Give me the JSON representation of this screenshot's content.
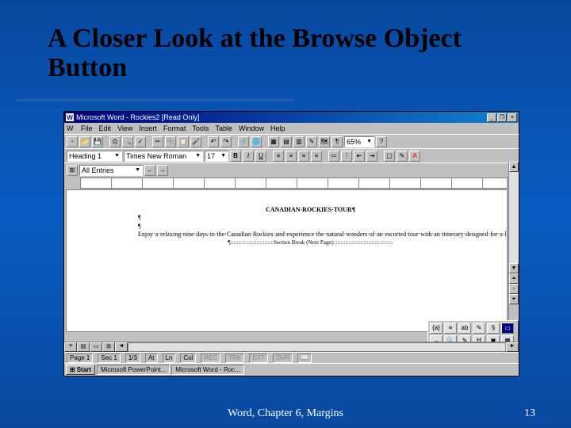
{
  "slide": {
    "title": "A Closer Look at the Browse Object Button",
    "footer_center": "Word, Chapter 6, Margins",
    "footer_right": "13"
  },
  "word": {
    "titlebar": "Microsoft Word - Rockies2 [Read Only]",
    "menus": [
      "File",
      "Edit",
      "View",
      "Insert",
      "Format",
      "Tools",
      "Table",
      "Window",
      "Help"
    ],
    "style": "Heading 1",
    "font": "Times New Roman",
    "size": "17",
    "zoom": "65%",
    "outline_level": "All Entries",
    "doc_heading": "CANADIAN·ROCKIES·TOUR",
    "body1": "Enjoy·a·relaxing·nine·days·in·the·Canadian·Rockies·and·experience·the·natural·wonders·of·an·escorted·tour·with·an·itinerary·designed·for·a·leisurely·pace.·Every·hotel·is·scheduled·for·two·nights·so·you·can·unwind·and·savor·the·scenery·and·the·inner·spa.",
    "section_break": "::::::::::::::::::::::::::::Section Break (Next Page):::::::::::::::::::::::::::::::::::::::",
    "status": {
      "page": "Page 1",
      "sec": "Sec 1",
      "pages": "1/3",
      "at": "At",
      "ln": "Ln",
      "col": "Col",
      "rec": "REC",
      "trk": "TRK",
      "ext": "EXT",
      "ovr": "OVR"
    },
    "browse_label": "Browse by Page",
    "taskbar": {
      "start": "Start",
      "task1": "Microsoft PowerPoint...",
      "task2": "Microsoft Word - Roc..."
    }
  }
}
